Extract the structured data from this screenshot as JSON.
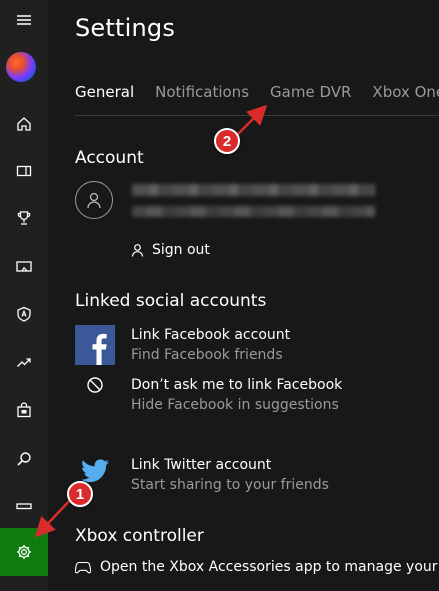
{
  "page": {
    "title": "Settings"
  },
  "tabs": [
    {
      "label": "General",
      "active": true
    },
    {
      "label": "Notifications",
      "active": false
    },
    {
      "label": "Game DVR",
      "active": false
    },
    {
      "label": "Xbox One",
      "active": false
    }
  ],
  "account": {
    "heading": "Account",
    "sign_out_label": "Sign out"
  },
  "linked": {
    "heading": "Linked social accounts",
    "facebook": {
      "title": "Link Facebook account",
      "subtitle": "Find Facebook friends"
    },
    "dont_ask": {
      "title": "Don’t ask me to link Facebook",
      "subtitle": "Hide Facebook in suggestions"
    },
    "twitter": {
      "title": "Link Twitter account",
      "subtitle": "Start sharing to your friends"
    }
  },
  "controller": {
    "heading": "Xbox controller",
    "text": "Open the Xbox Accessories app to manage your controller"
  },
  "sidebar": {
    "items": [
      {
        "icon": "hamburger-menu-icon"
      },
      {
        "icon": "user-avatar"
      },
      {
        "icon": "home-icon"
      },
      {
        "icon": "my-games-icon"
      },
      {
        "icon": "trophy-icon"
      },
      {
        "icon": "game-dvr-icon"
      },
      {
        "icon": "clubs-shield-icon"
      },
      {
        "icon": "trending-icon"
      },
      {
        "icon": "store-bag-icon"
      },
      {
        "icon": "search-icon"
      },
      {
        "icon": "connect-console-icon"
      },
      {
        "icon": "settings-gear-icon",
        "active": true
      }
    ]
  },
  "annotations": {
    "marker1": "1",
    "marker2": "2"
  },
  "colors": {
    "accent": "#107c10",
    "background": "#181818",
    "sidebar": "#202020",
    "facebook": "#3b5998",
    "twitter": "#55acee",
    "annotation": "#d92b2b"
  }
}
